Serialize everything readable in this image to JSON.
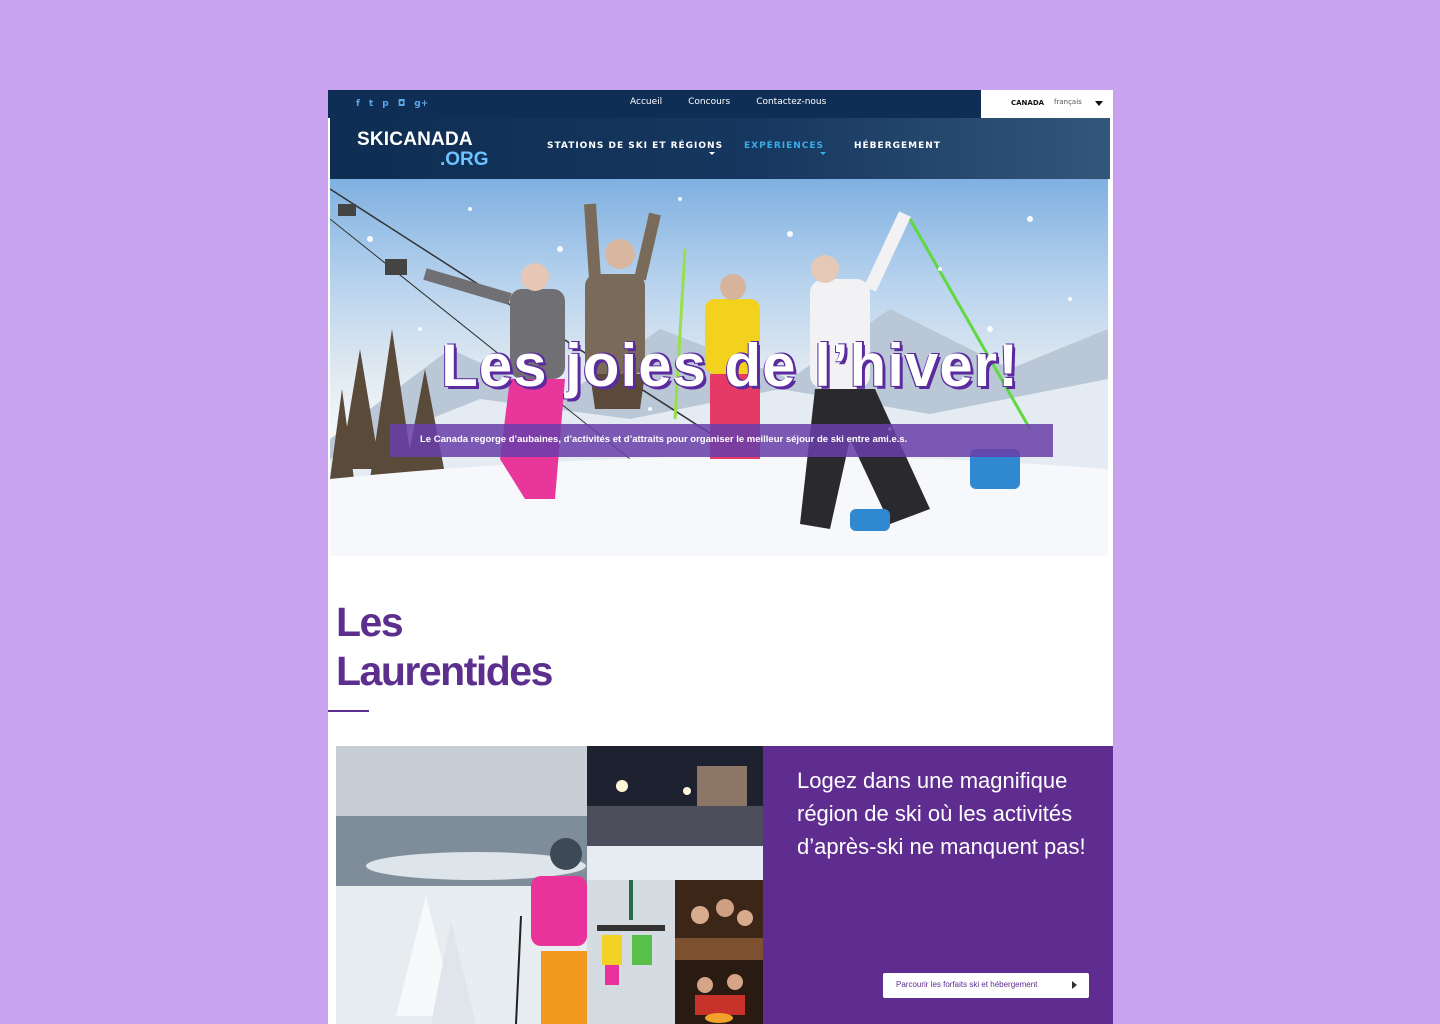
{
  "social": {
    "icons": [
      "facebook-icon",
      "twitter-icon",
      "pinterest-icon",
      "instagram-icon",
      "google-plus-icon"
    ],
    "glyphs": [
      "f",
      "t",
      "p",
      "◘",
      "g+"
    ]
  },
  "topnav": {
    "items": [
      "Accueil",
      "Concours",
      "Contactez-nous"
    ]
  },
  "lang": {
    "country": "CANADA",
    "language": "français"
  },
  "logo": {
    "line1": "SKICANADA",
    "line2": ".ORG"
  },
  "mainnav": {
    "items": [
      {
        "label": "STATIONS DE SKI ET RÉGIONS",
        "dropdown": true,
        "active": false
      },
      {
        "label": "EXPÉRIENCES",
        "dropdown": true,
        "active": true
      },
      {
        "label": "HÉBERGEMENT",
        "dropdown": false,
        "active": false
      }
    ]
  },
  "hero": {
    "title": "Les joies de l’hiver!",
    "subtitle": "Le Canada regorge d’aubaines, d’activités et d’attraits pour organiser le meilleur séjour de ski entre ami.e.s."
  },
  "section": {
    "title_line1": "Les",
    "title_line2": "Laurentides"
  },
  "promo": {
    "text": "Logez dans une magnifique région de ski où les activités d’après-ski ne manquent pas!",
    "button_label": "Parcourir les forfaits ski et hébergement"
  },
  "colors": {
    "background": "#c9a3ef",
    "navy": "#0f2e55",
    "accent_blue": "#38aee8",
    "purple": "#5e2d8f",
    "heading_purple": "#5c2f8f"
  }
}
